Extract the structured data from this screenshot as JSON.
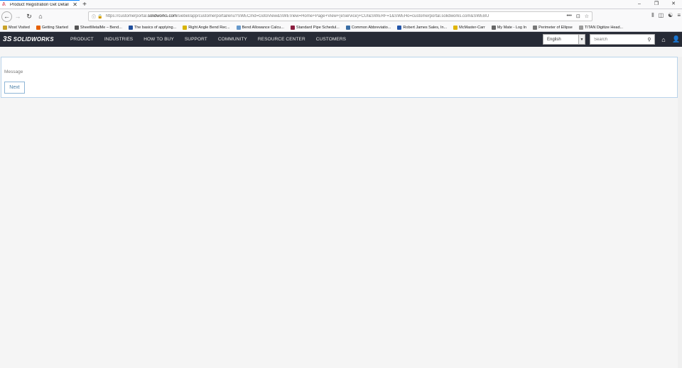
{
  "browser": {
    "tab_title": "Product Registration Get Detail",
    "tab_close": "✕",
    "new_tab": "+",
    "window_controls": [
      "–",
      "❐",
      "✕"
    ],
    "url_prefix": "https://customerportal.",
    "url_domain": "solidworks.com",
    "url_rest": "/siebel/app/customerportal/enu?SWECmd=GotoView&SWEView=Home+Page+View+(eService)+CUI&SWERF=1&SWEHo=customerportal.solidworks.com&SWEBU",
    "bookmarks": [
      {
        "label": "Most Visited",
        "color": "#c9a227"
      },
      {
        "label": "Getting Started",
        "color": "#e66000"
      },
      {
        "label": "SheetMetalMe – Bend...",
        "color": "#555555"
      },
      {
        "label": "The basics of applying...",
        "color": "#1f4e9c"
      },
      {
        "label": "Right Angle Bend Rec...",
        "color": "#d8b400"
      },
      {
        "label": "Bend Allowance Calcu...",
        "color": "#6699cc"
      },
      {
        "label": "Standard Pipe Schedul...",
        "color": "#8b1e3f"
      },
      {
        "label": "Common Abbreviatio...",
        "color": "#3a6ea5"
      },
      {
        "label": "Robert James Sales, In...",
        "color": "#2255aa"
      },
      {
        "label": "McMaster-Carr",
        "color": "#e0b400"
      },
      {
        "label": "My Mate - Log In",
        "color": "#666666"
      },
      {
        "label": "Perimeter of Ellipse",
        "color": "#777777"
      },
      {
        "label": "TITAN Digitize Head...",
        "color": "#999999"
      }
    ]
  },
  "site": {
    "logo_ds": "3S",
    "logo_name": "SOLIDWORKS",
    "menu": [
      "PRODUCT",
      "INDUSTRIES",
      "HOW TO BUY",
      "SUPPORT",
      "COMMUNITY",
      "RESOURCE CENTER",
      "CUSTOMERS"
    ],
    "language": "English",
    "search_placeholder": "Search"
  },
  "content": {
    "message_label": "Message",
    "next_label": "Next"
  },
  "colors": {
    "header_bg": "#272b36",
    "panel_border": "#b9d3ea",
    "button_text": "#4a7fa8"
  }
}
